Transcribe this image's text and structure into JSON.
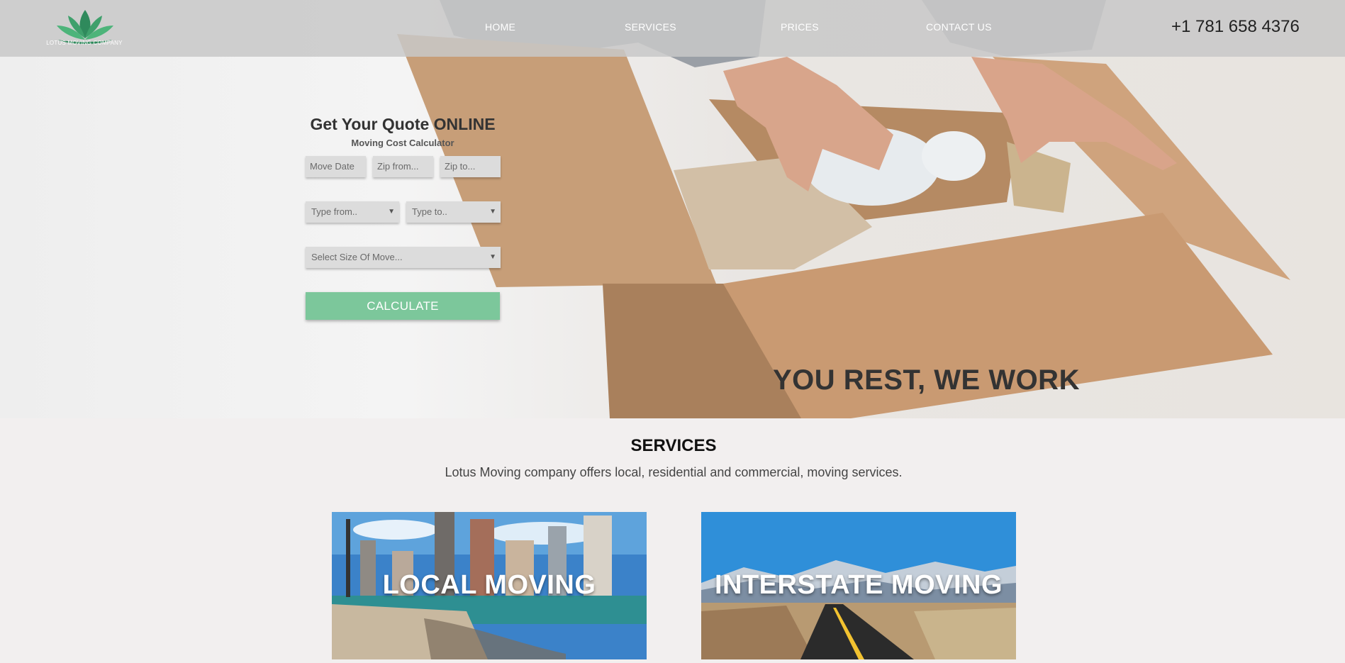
{
  "brand": {
    "name": "LOTUS MOVING COMPANY",
    "logo_icon": "lotus-icon",
    "accent": "#7cc79b"
  },
  "nav": {
    "items": [
      "HOME",
      "SERVICES",
      "PRICES",
      "CONTACT US"
    ]
  },
  "phone": "+1 781 658 4376",
  "quote": {
    "title": "Get Your Quote ONLINE",
    "subtitle": "Moving Cost Calculator",
    "move_date_placeholder": "Move Date",
    "zip_from_placeholder": "Zip from...",
    "zip_to_placeholder": "Zip to...",
    "type_from": "Type from..",
    "type_to": "Type to..",
    "size": "Select Size Of Move...",
    "calculate": "CALCULATE"
  },
  "hero": {
    "slogan": "YOU REST, WE WORK"
  },
  "services": {
    "title": "SERVICES",
    "description": "Lotus Moving company offers local, residential and commercial, moving services.",
    "cards": [
      "LOCAL MOVING",
      "INTERSTATE MOVING"
    ]
  }
}
